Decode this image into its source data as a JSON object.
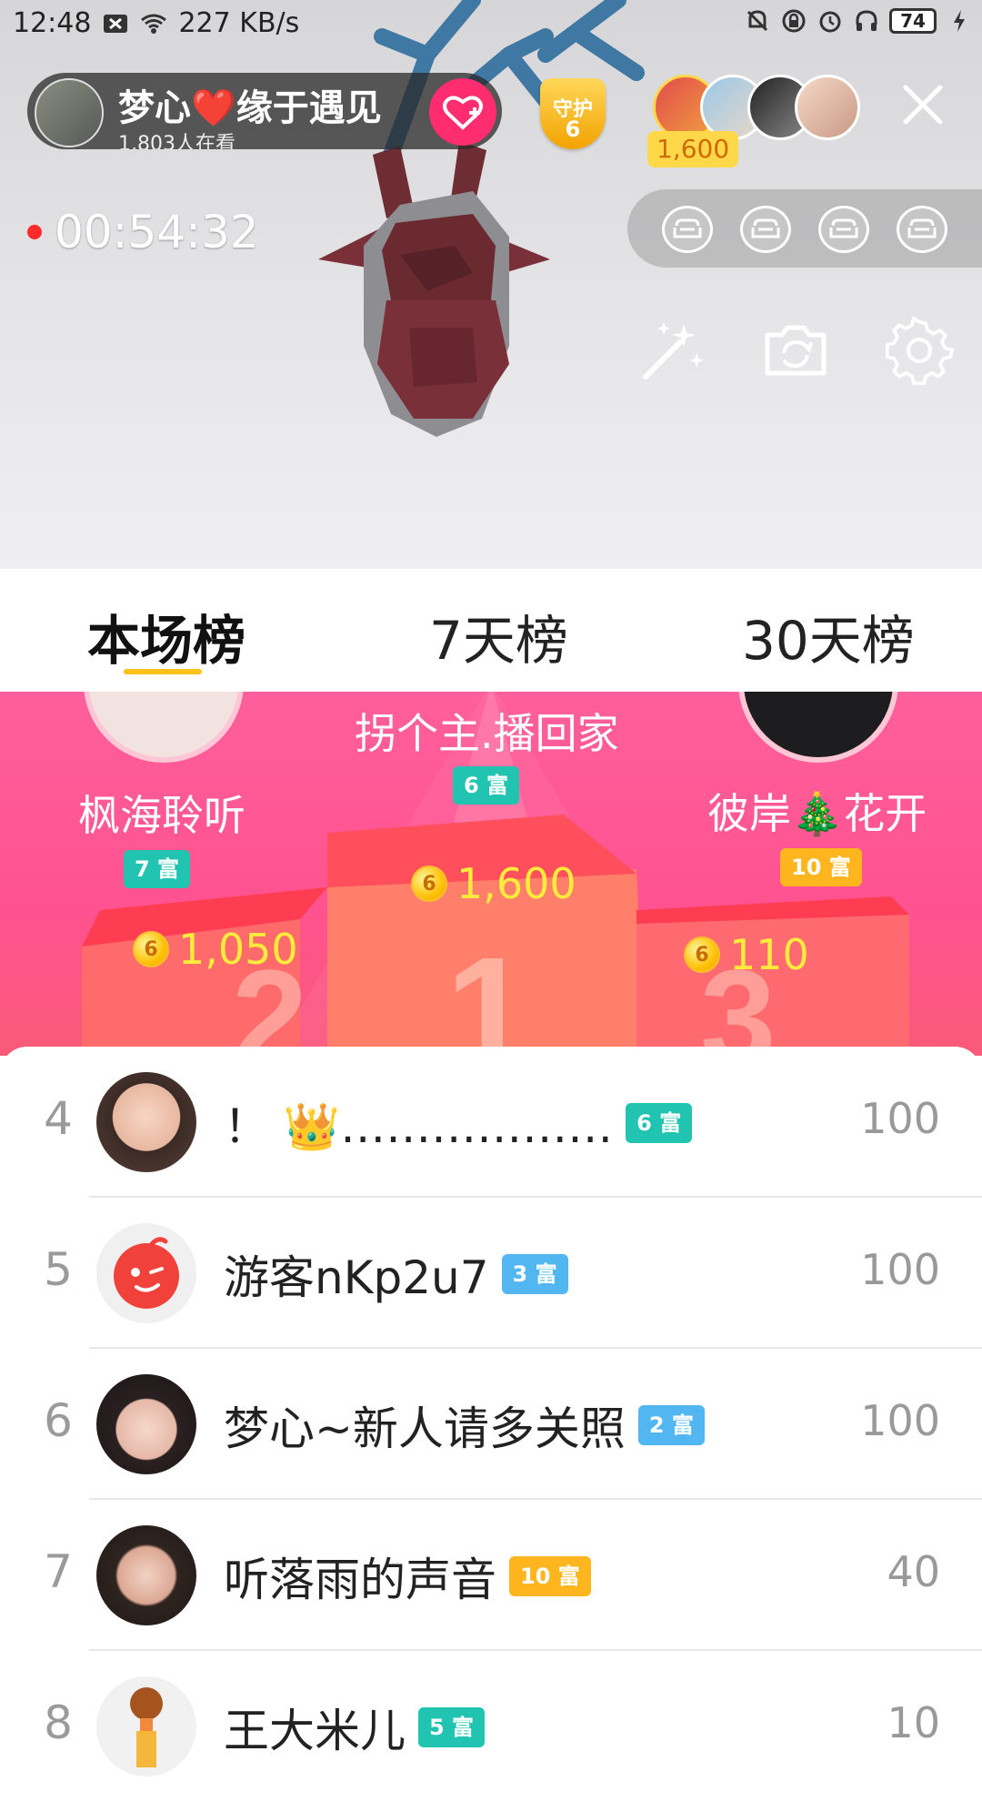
{
  "status_bar": {
    "time": "12:48",
    "network_speed": "227 KB/s",
    "battery": "74",
    "icons": [
      "notification-icon",
      "wifi-icon",
      "alarm-off-icon",
      "lock-rotation-icon",
      "alarm-icon",
      "headphones-icon",
      "battery-icon",
      "charging-icon"
    ]
  },
  "live": {
    "host_name": "梦心❤️缘于遇见",
    "viewers_text": "1,803人在看",
    "guard_badge_label": "守护",
    "guard_badge_level": "6",
    "top_contribution": "1,600",
    "timer": "00:54:32",
    "seat_count": 4,
    "tools": [
      "magic-wand-icon",
      "flip-camera-icon",
      "settings-gear-icon"
    ]
  },
  "tabs": [
    {
      "label": "本场榜",
      "active": true
    },
    {
      "label": "7天榜",
      "active": false
    },
    {
      "label": "30天榜",
      "active": false
    }
  ],
  "podium": {
    "first": {
      "name": "拐个主.播回家",
      "level": "6 富",
      "score": "1,600"
    },
    "second": {
      "name": "枫海聆听",
      "level": "7 富",
      "score": "1,050"
    },
    "third": {
      "name": "彼岸🎄花开",
      "level": "10 富",
      "score": "110"
    },
    "coin_label": "6"
  },
  "ranking": [
    {
      "rank": "4",
      "name": "！ 👑………………",
      "level": "6 富",
      "score": "100",
      "level_color": "#21c4b0"
    },
    {
      "rank": "5",
      "name": "游客nKp2u7",
      "level": "3 富",
      "score": "100",
      "level_color": "#52b7f1"
    },
    {
      "rank": "6",
      "name": "梦心~新人请多关照",
      "level": "2 富",
      "score": "100",
      "level_color": "#52b7f1"
    },
    {
      "rank": "7",
      "name": "听落雨的声音",
      "level": "10 富",
      "score": "40",
      "level_color": "#ffb61e"
    },
    {
      "rank": "8",
      "name": "王大米儿",
      "level": "5 富",
      "score": "10",
      "level_color": "#21c4b0"
    }
  ],
  "colors": {
    "accent_yellow": "#ffc21a",
    "podium_pink": "#ff5290",
    "level_teal": "#21c4b0",
    "level_blue": "#52b7f1",
    "level_orange": "#ffb61e",
    "follow_pink": "#ff2d6f"
  }
}
